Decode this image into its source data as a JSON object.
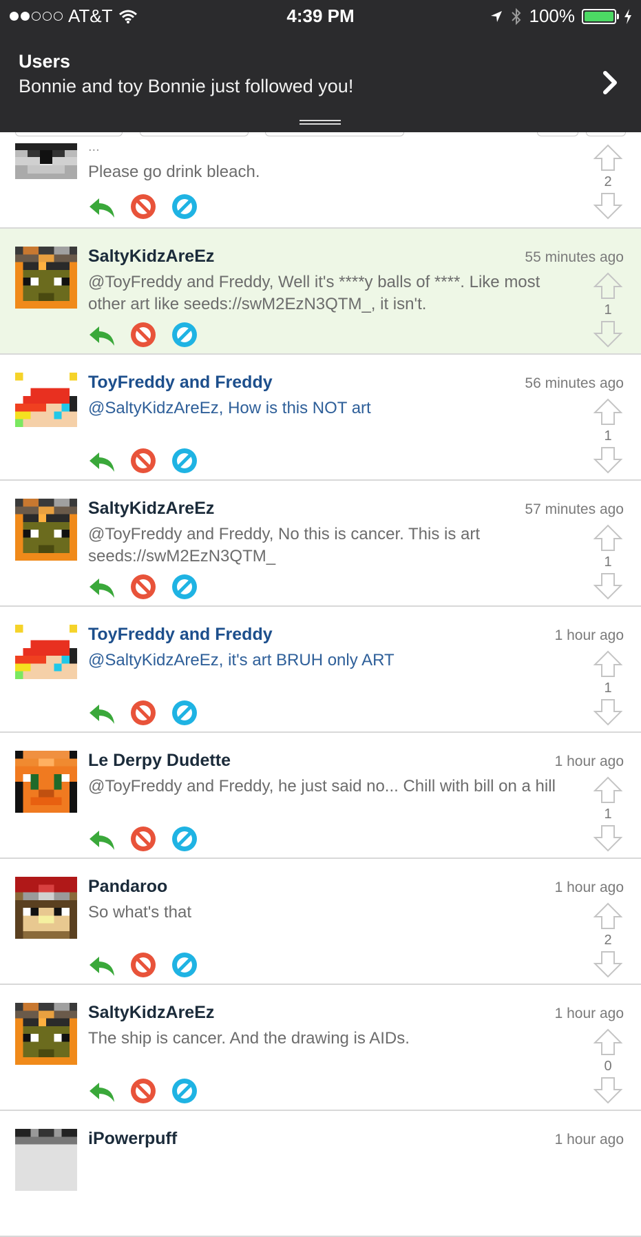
{
  "status_bar": {
    "carrier": "AT&T",
    "time": "4:39 PM",
    "battery": "100%",
    "signal_bars_filled": 2,
    "signal_bars_total": 5
  },
  "notification": {
    "title": "Users",
    "body": "Bonnie and toy Bonnie just followed you!"
  },
  "colors": {
    "reply": "#3aa83a",
    "block": "#e8533a",
    "mute": "#1fb3e3",
    "highlight": "#eef7e6"
  },
  "posts": [
    {
      "user": "",
      "time": "",
      "ellipsis": "...",
      "text": "Please go drink bleach.",
      "votes": "2"
    },
    {
      "user": "SaltyKidzAreEz",
      "time": "55 minutes ago",
      "text": "@ToyFreddy and Freddy, Well it's ****y balls of ****. Like most other art like seeds://swM2EzN3QTM_, it isn't.",
      "votes": "1"
    },
    {
      "user": "ToyFreddy and Freddy",
      "time": "56 minutes ago",
      "text": "@SaltyKidzAreEz, How is this NOT art",
      "votes": "1"
    },
    {
      "user": "SaltyKidzAreEz",
      "time": "57 minutes ago",
      "text": "@ToyFreddy and Freddy, No this is cancer. This is art seeds://swM2EzN3QTM_",
      "votes": "1"
    },
    {
      "user": "ToyFreddy and Freddy",
      "time": "1 hour ago",
      "text": "@SaltyKidzAreEz, it's art BRUH only ART",
      "votes": "1"
    },
    {
      "user": "Le Derpy Dudette",
      "time": "1 hour ago",
      "text": "@ToyFreddy and Freddy, he just said no... Chill with bill on a hill",
      "votes": "1"
    },
    {
      "user": "Pandaroo",
      "time": "1 hour ago",
      "text": "So what's that",
      "votes": "2"
    },
    {
      "user": "SaltyKidzAreEz",
      "time": "1 hour ago",
      "text": "The ship is cancer. And the drawing is AIDs.",
      "votes": "0"
    },
    {
      "user": "iPowerpuff",
      "time": "1 hour ago",
      "text": "",
      "votes": ""
    }
  ]
}
